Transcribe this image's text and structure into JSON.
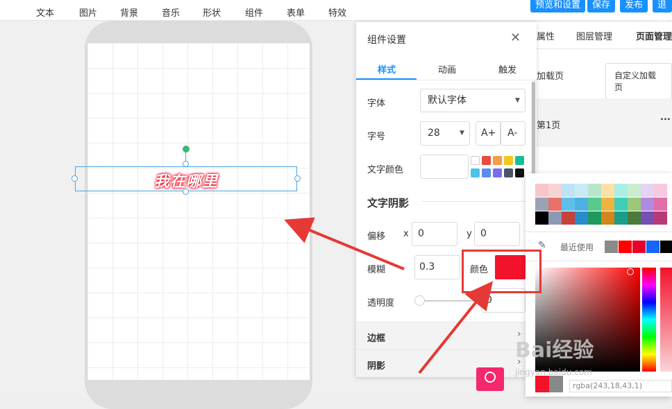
{
  "toolbar": {
    "items": [
      "文本",
      "图片",
      "背景",
      "音乐",
      "形状",
      "组件",
      "表单",
      "特效"
    ],
    "preview_label": "预览和设置",
    "save_label": "保存",
    "publish_label": "发布",
    "exit_label": "退出"
  },
  "canvas": {
    "text": "我在哪里"
  },
  "settings": {
    "title": "组件设置",
    "tabs": [
      "样式",
      "动画",
      "触发"
    ],
    "font_label": "字体",
    "font_value": "默认字体",
    "size_label": "字号",
    "size_value": "28",
    "size_inc": "A+",
    "size_dec": "A-",
    "text_color_label": "文字颜色",
    "shadow_heading": "文字阴影",
    "offset_label": "偏移",
    "x_label": "x",
    "x_value": "0",
    "y_label": "y",
    "y_value": "0",
    "blur_label": "模糊",
    "blur_value": "0.3",
    "color_label": "颜色",
    "shadow_color": "#f3122b",
    "opacity_label": "透明度",
    "opacity_value": "0",
    "border_section": "边框",
    "shadow_section": "阴影",
    "swatches": [
      "#ffffff",
      "#e94b3c",
      "#f39c4a",
      "#f5c518",
      "#1abc9c",
      "#4cc3e8",
      "#5b8dee",
      "#7b6cf0",
      "#4a5568",
      "#111111"
    ]
  },
  "right_panel": {
    "tabs": [
      "属性",
      "图层管理",
      "页面管理"
    ],
    "add_page_label": "加载页",
    "custom_page_button": "自定义加载页",
    "page_item": "第1页",
    "more_icon": "..."
  },
  "color_picker": {
    "recent_label": "最近使用",
    "recent_colors": [
      "#8a8a8a",
      "#ff0000",
      "#e8002d",
      "#1565ff",
      "#000000"
    ],
    "rgba_value": "rgba(243,18,43,1)"
  },
  "watermark": {
    "brand": "Bai经验",
    "url": "jingyan.baidu.com"
  }
}
